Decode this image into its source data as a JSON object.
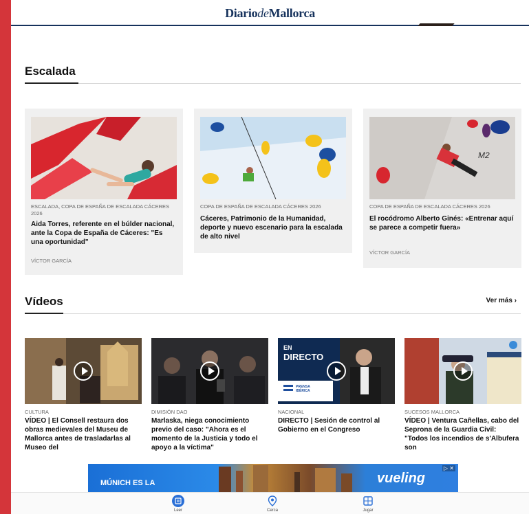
{
  "header": {
    "logo_part1": "Diario",
    "logo_part2": "de",
    "logo_part3": "Mallorca"
  },
  "escalada": {
    "title": "Escalada",
    "cards": [
      {
        "category": "ESCALADA, COPA DE ESPAÑA DE ESCALADA CÁCERES 2026",
        "title": "Aida Torres, referente en el búlder nacional, ante la Copa de España de Cáceres: \"Es una oportunidad\"",
        "author": "VÍCTOR GARCÍA"
      },
      {
        "category": "COPA DE ESPAÑA DE ESCALADA CÁCERES 2026",
        "title": "Cáceres, Patrimonio de la Humanidad, deporte y nuevo escenario para la escalada de alto nivel",
        "author": ""
      },
      {
        "category": "COPA DE ESPAÑA DE ESCALADA CÁCERES 2026",
        "title": "El rocódromo Alberto Ginés: «Entrenar aquí se parece a competir fuera»",
        "author": "VÍCTOR GARCÍA"
      }
    ]
  },
  "videos": {
    "title": "Vídeos",
    "more": "Ver más ›",
    "items": [
      {
        "category": "CULTURA",
        "title": "VÍDEO | El Consell restaura dos obras medievales del Museu de Mallorca antes de trasladarlas al Museo del"
      },
      {
        "category": "DIMISIÓN DAO",
        "title": "Marlaska, niega conocimiento previo del caso: \"Ahora es el momento de la Justicia y todo el apoyo a la víctima\""
      },
      {
        "category": "NACIONAL",
        "title": "DIRECTO | Sesión de control al Gobierno en el Congreso",
        "overlay_en": "EN",
        "overlay_directo": "DIRECTO",
        "overlay_brand": "PRENSA IBÉRICA"
      },
      {
        "category": "SUCESOS MALLORCA",
        "title": "VÍDEO | Ventura Cañellas, cabo del Seprona de la Guardia Civil: \"Todos los incendios de s'Albufera son"
      }
    ]
  },
  "ad": {
    "left_text": "MÚNICH ES LA",
    "right_text": "vueling",
    "badge": "▷ ✕"
  },
  "bottom_nav": [
    {
      "label": "Leer",
      "icon": "newspaper-icon"
    },
    {
      "label": "Cerca",
      "icon": "location-pin-icon"
    },
    {
      "label": "Jugar",
      "icon": "game-grid-icon"
    }
  ],
  "colors": {
    "brand": "#16325c",
    "frame": "#d4353a",
    "nav_active": "#2a6fd6"
  }
}
